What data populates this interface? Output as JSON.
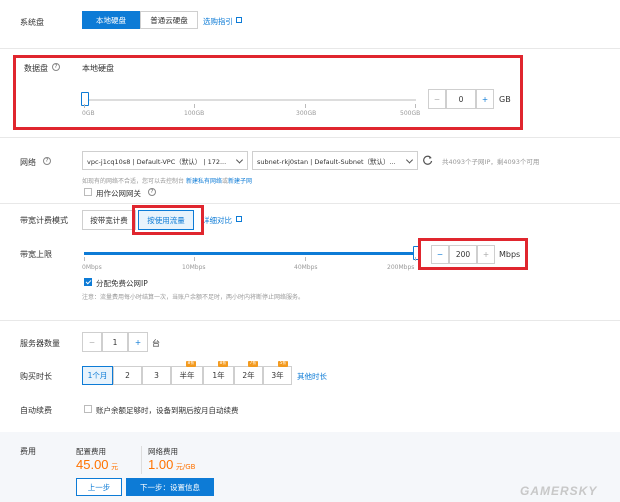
{
  "system_disk": {
    "label": "系统盘",
    "tab_local": "本地硬盘",
    "tab_cloud": "普通云硬盘",
    "select_link": "选购指引",
    "note": ""
  },
  "data_disk": {
    "label": "数据盘",
    "type_label": "本地硬盘",
    "ticks": [
      "0GB",
      "100GB",
      "300GB",
      "500GB"
    ],
    "stepper_minus": "−",
    "value": "0",
    "stepper_plus": "+",
    "unit": "GB"
  },
  "network": {
    "label": "网络",
    "vpc": "vpc-j1cq10s8 | Default-VPC（默认） | 172...",
    "subnet": "subnet-rkj0stan | Default-Subnet（默认）...",
    "available": "共4093个子网IP，剩4093个可用",
    "hint_prefix": "如现有的网络不合适，您可以去控制台",
    "new_vpc": "新建私有网络",
    "or": "或",
    "new_subnet": "新建子网",
    "public_gateway": "用作公网网关"
  },
  "billing": {
    "label": "带宽计费模式",
    "by_bandwidth": "按带宽计费",
    "by_traffic": "按使用流量",
    "compare": "详细对比"
  },
  "bandwidth": {
    "label": "带宽上限",
    "ticks": [
      "0Mbps",
      "10Mbps",
      "40Mbps",
      "200Mbps"
    ],
    "stepper_minus": "−",
    "value": "200",
    "stepper_plus": "+",
    "unit": "Mbps",
    "free_ip": "分配免费公网IP",
    "note": "注意：流量费用每小时结算一次，当账户余额不足时，两小时内将断停止网络服务。"
  },
  "server_count": {
    "label": "服务器数量",
    "minus": "−",
    "value": "1",
    "plus": "+",
    "unit": "台"
  },
  "duration": {
    "label": "购买时长",
    "options": [
      {
        "label": "1个月",
        "badge": ""
      },
      {
        "label": "2",
        "badge": ""
      },
      {
        "label": "3",
        "badge": ""
      },
      {
        "label": "半年",
        "badge": "8折"
      },
      {
        "label": "1年",
        "badge": "8折"
      },
      {
        "label": "2年",
        "badge": "7折"
      },
      {
        "label": "3年",
        "badge": "5折"
      }
    ],
    "other": "其他时长"
  },
  "auto_renew": {
    "label": "自动续费",
    "text": "账户余额足够时，设备到期后按月自动续费"
  },
  "cost": {
    "label": "费用",
    "config_label": "配置费用",
    "config_value": "45.00",
    "config_unit": "元",
    "network_label": "网络费用",
    "network_value": "1.00",
    "network_unit": "元/GB"
  },
  "actions": {
    "prev": "上一步",
    "next": "下一步：设置信息"
  },
  "watermark": "GAMERSKY",
  "colors": {
    "accent": "#0d7bd6",
    "price": "#ff7300",
    "highlight": "#e0262e",
    "badge": "#f39a1e"
  }
}
